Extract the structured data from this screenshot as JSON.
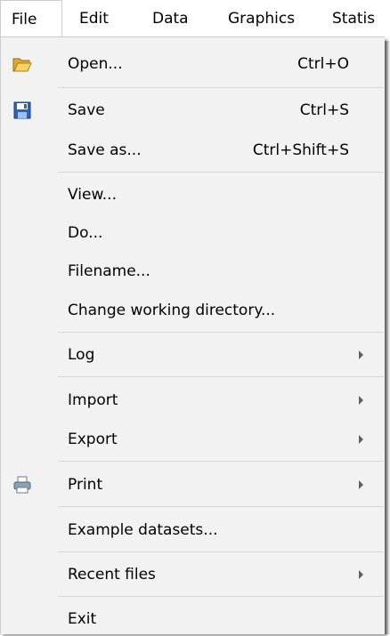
{
  "menubar": {
    "file": "File",
    "edit": "Edit",
    "data": "Data",
    "graphics": "Graphics",
    "statistics": "Statis"
  },
  "file_menu": {
    "open": {
      "label": "Open...",
      "shortcut": "Ctrl+O",
      "icon": "folder-open-icon"
    },
    "save": {
      "label": "Save",
      "shortcut": "Ctrl+S",
      "icon": "floppy-disk-icon"
    },
    "save_as": {
      "label": "Save as...",
      "shortcut": "Ctrl+Shift+S"
    },
    "view": {
      "label": "View..."
    },
    "do": {
      "label": "Do..."
    },
    "filename": {
      "label": "Filename..."
    },
    "change_dir": {
      "label": "Change working directory..."
    },
    "log": {
      "label": "Log",
      "submenu": true
    },
    "import": {
      "label": "Import",
      "submenu": true
    },
    "export": {
      "label": "Export",
      "submenu": true
    },
    "print": {
      "label": "Print",
      "submenu": true,
      "icon": "printer-icon"
    },
    "example_datasets": {
      "label": "Example datasets..."
    },
    "recent_files": {
      "label": "Recent files",
      "submenu": true
    },
    "exit": {
      "label": "Exit"
    }
  },
  "colors": {
    "menu_background": "#f2f2f2",
    "separator": "#d7d7d7",
    "border": "#cccccc"
  }
}
